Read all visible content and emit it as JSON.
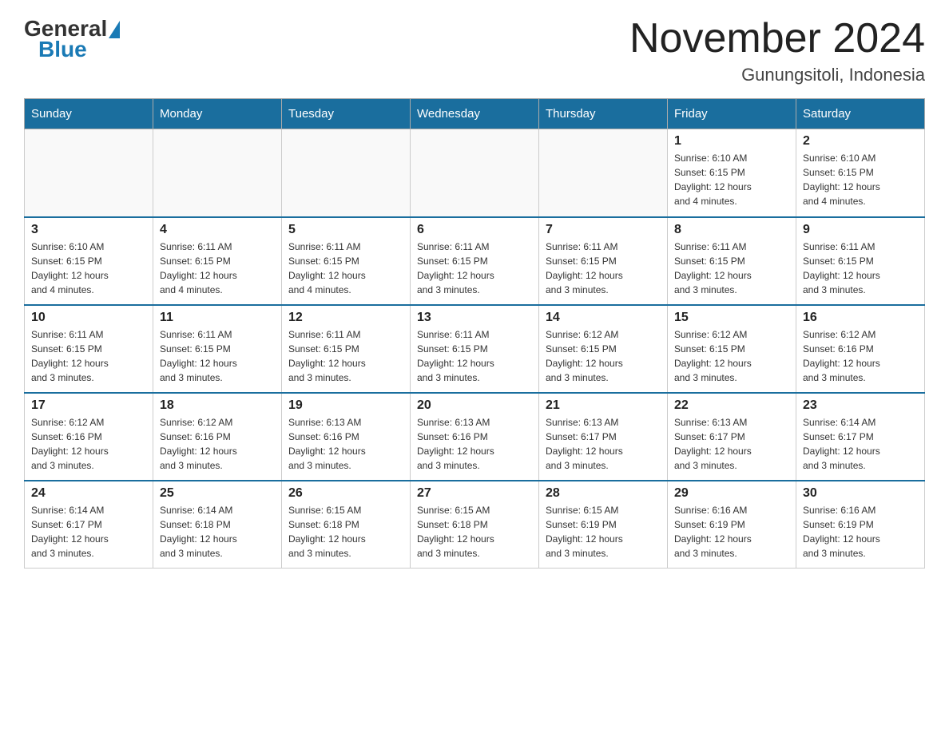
{
  "header": {
    "logo_general": "General",
    "logo_blue": "Blue",
    "month_title": "November 2024",
    "location": "Gunungsitoli, Indonesia"
  },
  "weekdays": [
    "Sunday",
    "Monday",
    "Tuesday",
    "Wednesday",
    "Thursday",
    "Friday",
    "Saturday"
  ],
  "weeks": [
    [
      {
        "day": "",
        "info": ""
      },
      {
        "day": "",
        "info": ""
      },
      {
        "day": "",
        "info": ""
      },
      {
        "day": "",
        "info": ""
      },
      {
        "day": "",
        "info": ""
      },
      {
        "day": "1",
        "info": "Sunrise: 6:10 AM\nSunset: 6:15 PM\nDaylight: 12 hours\nand 4 minutes."
      },
      {
        "day": "2",
        "info": "Sunrise: 6:10 AM\nSunset: 6:15 PM\nDaylight: 12 hours\nand 4 minutes."
      }
    ],
    [
      {
        "day": "3",
        "info": "Sunrise: 6:10 AM\nSunset: 6:15 PM\nDaylight: 12 hours\nand 4 minutes."
      },
      {
        "day": "4",
        "info": "Sunrise: 6:11 AM\nSunset: 6:15 PM\nDaylight: 12 hours\nand 4 minutes."
      },
      {
        "day": "5",
        "info": "Sunrise: 6:11 AM\nSunset: 6:15 PM\nDaylight: 12 hours\nand 4 minutes."
      },
      {
        "day": "6",
        "info": "Sunrise: 6:11 AM\nSunset: 6:15 PM\nDaylight: 12 hours\nand 3 minutes."
      },
      {
        "day": "7",
        "info": "Sunrise: 6:11 AM\nSunset: 6:15 PM\nDaylight: 12 hours\nand 3 minutes."
      },
      {
        "day": "8",
        "info": "Sunrise: 6:11 AM\nSunset: 6:15 PM\nDaylight: 12 hours\nand 3 minutes."
      },
      {
        "day": "9",
        "info": "Sunrise: 6:11 AM\nSunset: 6:15 PM\nDaylight: 12 hours\nand 3 minutes."
      }
    ],
    [
      {
        "day": "10",
        "info": "Sunrise: 6:11 AM\nSunset: 6:15 PM\nDaylight: 12 hours\nand 3 minutes."
      },
      {
        "day": "11",
        "info": "Sunrise: 6:11 AM\nSunset: 6:15 PM\nDaylight: 12 hours\nand 3 minutes."
      },
      {
        "day": "12",
        "info": "Sunrise: 6:11 AM\nSunset: 6:15 PM\nDaylight: 12 hours\nand 3 minutes."
      },
      {
        "day": "13",
        "info": "Sunrise: 6:11 AM\nSunset: 6:15 PM\nDaylight: 12 hours\nand 3 minutes."
      },
      {
        "day": "14",
        "info": "Sunrise: 6:12 AM\nSunset: 6:15 PM\nDaylight: 12 hours\nand 3 minutes."
      },
      {
        "day": "15",
        "info": "Sunrise: 6:12 AM\nSunset: 6:15 PM\nDaylight: 12 hours\nand 3 minutes."
      },
      {
        "day": "16",
        "info": "Sunrise: 6:12 AM\nSunset: 6:16 PM\nDaylight: 12 hours\nand 3 minutes."
      }
    ],
    [
      {
        "day": "17",
        "info": "Sunrise: 6:12 AM\nSunset: 6:16 PM\nDaylight: 12 hours\nand 3 minutes."
      },
      {
        "day": "18",
        "info": "Sunrise: 6:12 AM\nSunset: 6:16 PM\nDaylight: 12 hours\nand 3 minutes."
      },
      {
        "day": "19",
        "info": "Sunrise: 6:13 AM\nSunset: 6:16 PM\nDaylight: 12 hours\nand 3 minutes."
      },
      {
        "day": "20",
        "info": "Sunrise: 6:13 AM\nSunset: 6:16 PM\nDaylight: 12 hours\nand 3 minutes."
      },
      {
        "day": "21",
        "info": "Sunrise: 6:13 AM\nSunset: 6:17 PM\nDaylight: 12 hours\nand 3 minutes."
      },
      {
        "day": "22",
        "info": "Sunrise: 6:13 AM\nSunset: 6:17 PM\nDaylight: 12 hours\nand 3 minutes."
      },
      {
        "day": "23",
        "info": "Sunrise: 6:14 AM\nSunset: 6:17 PM\nDaylight: 12 hours\nand 3 minutes."
      }
    ],
    [
      {
        "day": "24",
        "info": "Sunrise: 6:14 AM\nSunset: 6:17 PM\nDaylight: 12 hours\nand 3 minutes."
      },
      {
        "day": "25",
        "info": "Sunrise: 6:14 AM\nSunset: 6:18 PM\nDaylight: 12 hours\nand 3 minutes."
      },
      {
        "day": "26",
        "info": "Sunrise: 6:15 AM\nSunset: 6:18 PM\nDaylight: 12 hours\nand 3 minutes."
      },
      {
        "day": "27",
        "info": "Sunrise: 6:15 AM\nSunset: 6:18 PM\nDaylight: 12 hours\nand 3 minutes."
      },
      {
        "day": "28",
        "info": "Sunrise: 6:15 AM\nSunset: 6:19 PM\nDaylight: 12 hours\nand 3 minutes."
      },
      {
        "day": "29",
        "info": "Sunrise: 6:16 AM\nSunset: 6:19 PM\nDaylight: 12 hours\nand 3 minutes."
      },
      {
        "day": "30",
        "info": "Sunrise: 6:16 AM\nSunset: 6:19 PM\nDaylight: 12 hours\nand 3 minutes."
      }
    ]
  ]
}
